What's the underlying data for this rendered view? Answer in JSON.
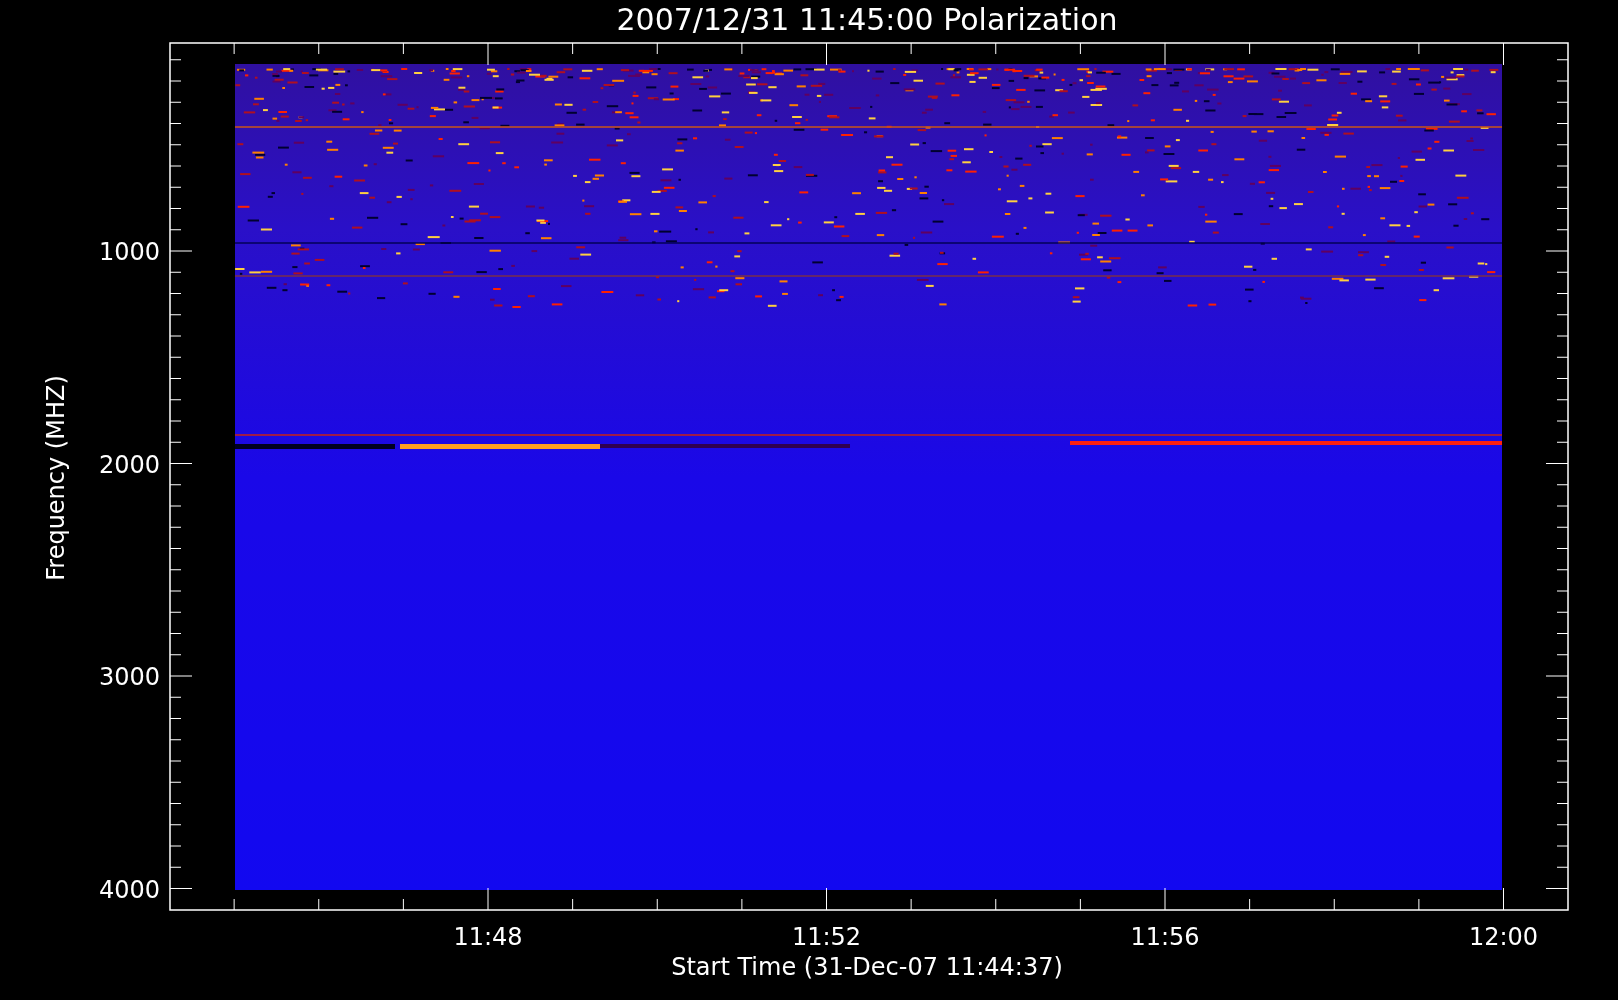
{
  "plot": {
    "title": "2007/12/31 11:45:00 Polarization",
    "xlabel": "Start Time (31-Dec-07 11:44:37)",
    "ylabel": "Frequency (MHZ)",
    "yticks": [
      "1000",
      "2000",
      "3000",
      "4000"
    ],
    "xticks": [
      "11:48",
      "11:52",
      "11:56",
      "12:00"
    ]
  }
}
